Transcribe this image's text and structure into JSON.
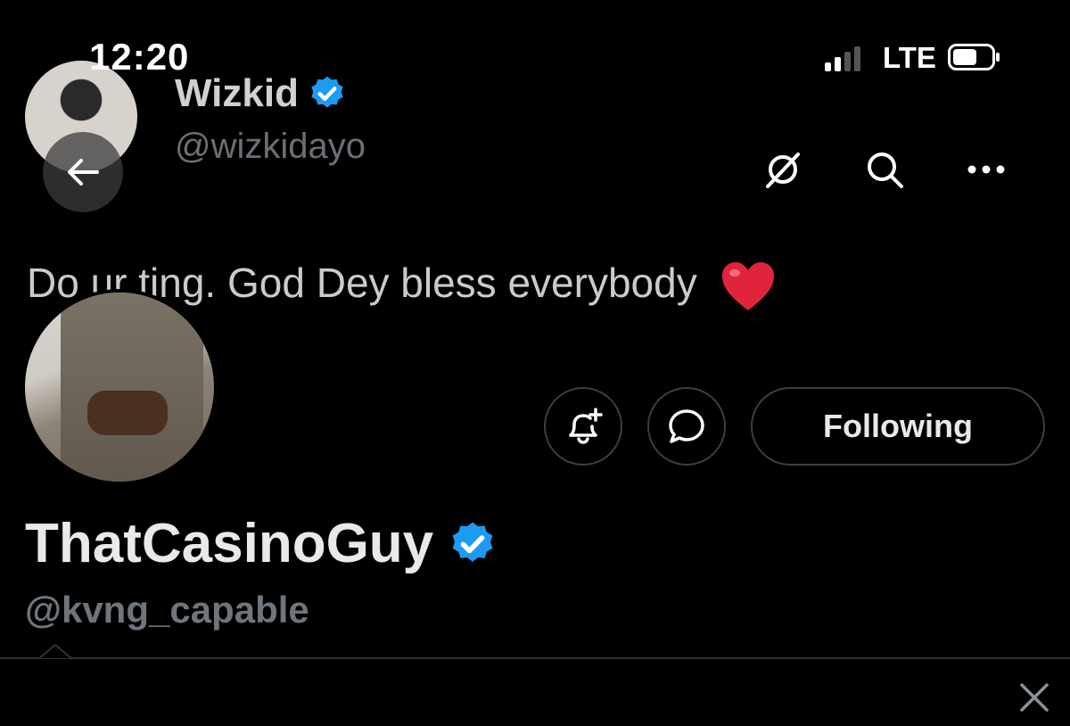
{
  "status_bar": {
    "time": "12:20",
    "network": "LTE",
    "signal_bars_active": 2,
    "signal_bars_total": 4
  },
  "quoted_tweet": {
    "author_name": "Wizkid",
    "author_handle": "@wizkidayo",
    "text": "Do ur ting. God Dey bless everybody",
    "emoji": "heart"
  },
  "profile": {
    "name": "ThatCasinoGuy",
    "handle": "@kvng_capable",
    "following_label": "Following"
  },
  "icons": {
    "back": "arrow-left-icon",
    "grok": "grok-icon",
    "search": "search-icon",
    "more": "more-icon",
    "notify": "bell-plus-icon",
    "message": "message-icon",
    "verified": "verified-badge-icon",
    "close": "close-icon"
  },
  "colors": {
    "background": "#000000",
    "verified": "#1d9bf0",
    "heart": "#e0243c",
    "border": "#3a3f44"
  }
}
